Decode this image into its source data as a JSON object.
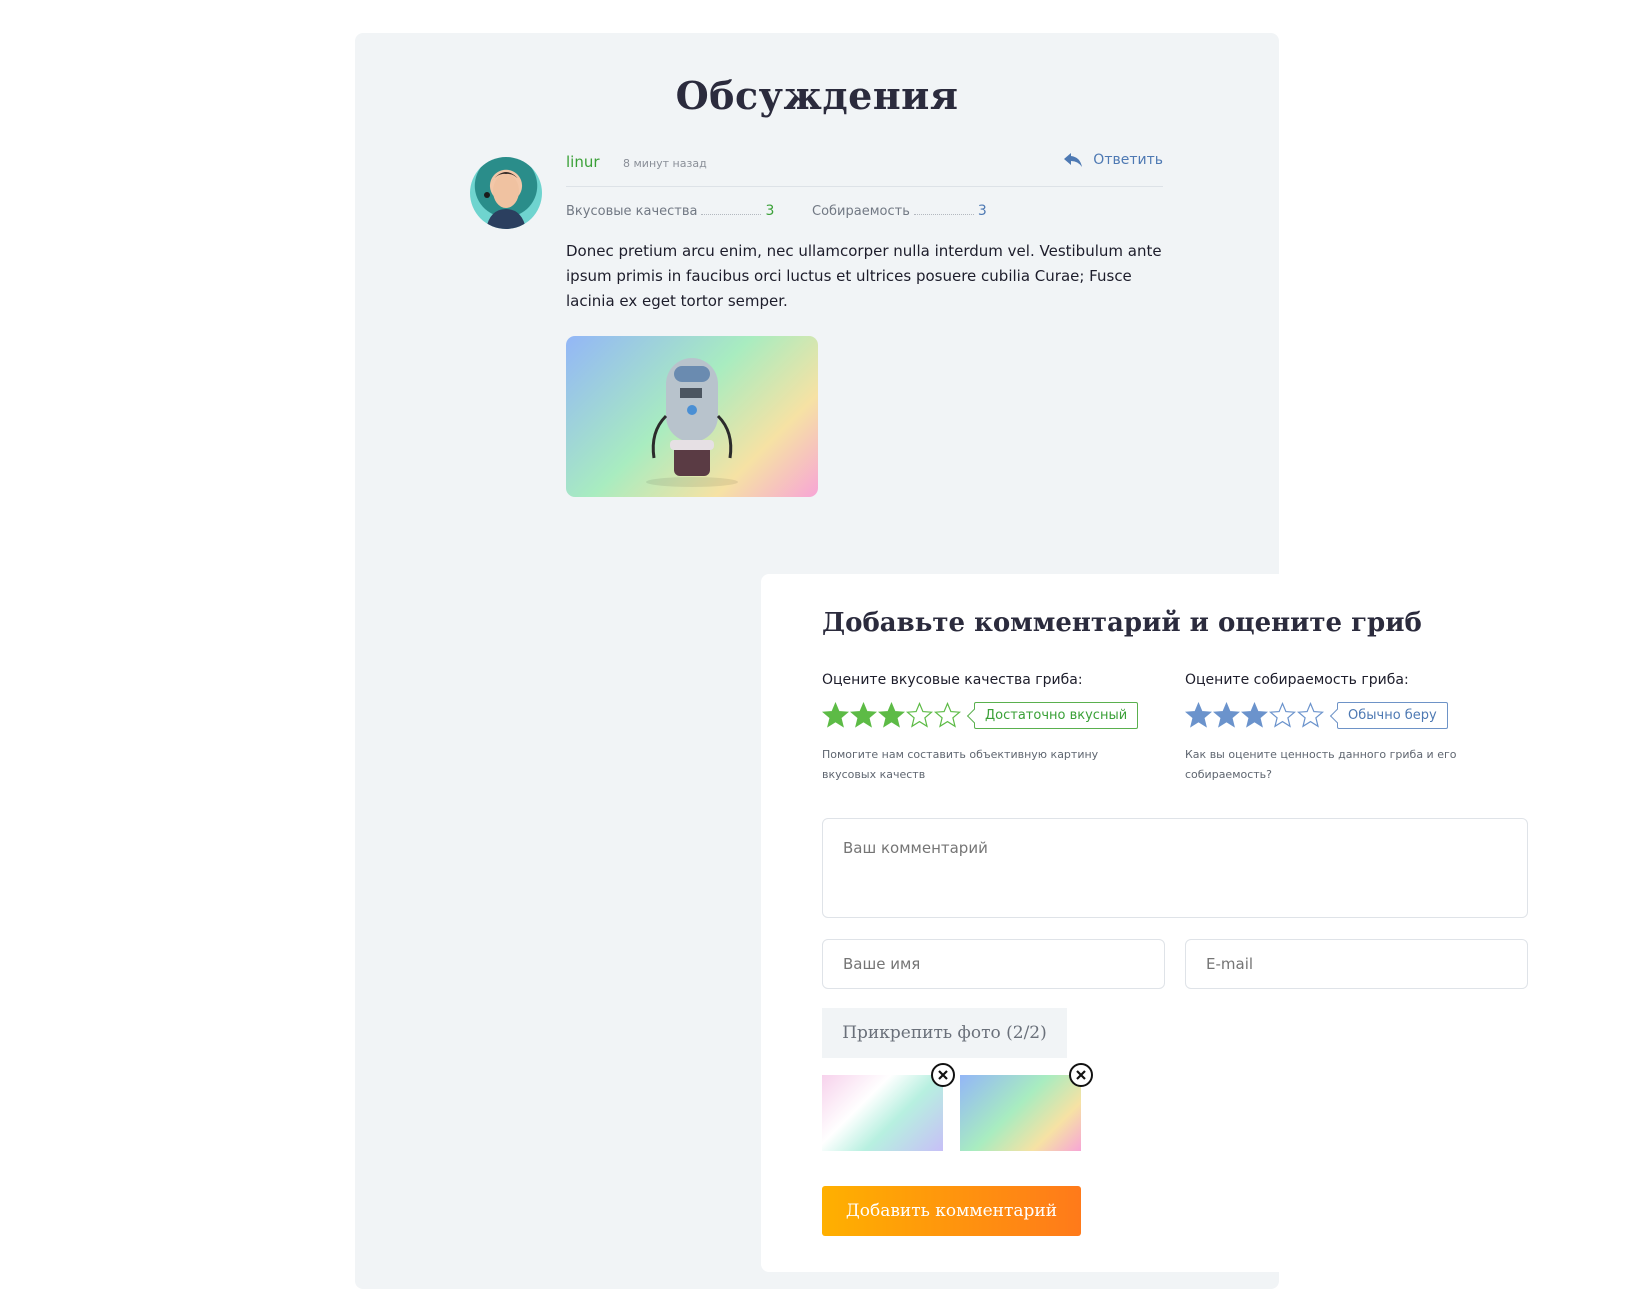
{
  "page": {
    "title": "Обсуждения"
  },
  "comment": {
    "author": "linur",
    "time": "8 минут назад",
    "reply_label": "Ответить",
    "ratings": [
      {
        "label": "Вкусовые качества",
        "value": "3"
      },
      {
        "label": "Собираемость",
        "value": "3"
      }
    ],
    "text": "Donec pretium arcu enim, nec ullamcorper nulla interdum vel. Vestibulum ante ipsum primis in faucibus orci luctus et ultrices posuere cubilia Curae; Fusce lacinia ex eget tortor semper.",
    "photo_icon": "robot-image"
  },
  "form": {
    "title": "Добавьте комментарий и оцените гриб",
    "taste": {
      "label": "Оцените вкусовые качества гриба:",
      "stars": 3,
      "max": 5,
      "tag": "Достаточно вкусный",
      "hint": "Помогите нам составить объективную картину вкусовых качеств",
      "color": "#5dbb46"
    },
    "collect": {
      "label": "Оцените собираемость гриба:",
      "stars": 3,
      "max": 5,
      "tag": "Обычно беру",
      "hint": "Как вы оцените ценность данного гриба и его собираемость?",
      "color": "#6b93cc"
    },
    "comment_placeholder": "Ваш комментарий",
    "name_placeholder": "Ваше имя",
    "email_placeholder": "E-mail",
    "attach_label": "Прикрепить фото (2/2)",
    "submit_label": "Добавить комментарий"
  },
  "colors": {
    "accent_green": "#3aa037",
    "accent_blue": "#4e79b3",
    "button_start": "#ffb000",
    "button_end": "#ff7a1a"
  }
}
